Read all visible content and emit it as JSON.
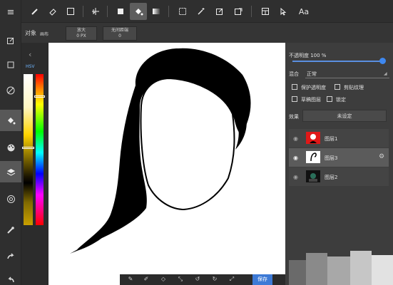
{
  "top_toolbar": {
    "text_tool_label": "Aa"
  },
  "options": {
    "object_label": "对象",
    "object_value": "画布",
    "zoom_label": "放大",
    "zoom_value": "0 PX",
    "snap_label": "无间距端",
    "snap_value": "0"
  },
  "color": {
    "mode_label": "HSV"
  },
  "layers_panel": {
    "opacity_label": "不透明度 100 %",
    "blend_label": "混合",
    "blend_value": "正常",
    "protect_alpha_label": "保护透明度",
    "clip_label": "剪贴纹理",
    "draft_label": "草稿图层",
    "lock_label": "锁定",
    "effect_label": "效果",
    "effect_value": "未设定",
    "layers": [
      {
        "name": "图层1",
        "selected": false
      },
      {
        "name": "图层3",
        "selected": true
      },
      {
        "name": "图层2",
        "selected": false
      }
    ]
  },
  "bottom_bar": {
    "save_label": "保存"
  },
  "colors": {
    "accent": "#3e88f0",
    "panel_bg": "#3d3d3d",
    "toolbar_bg": "#2f2f2f"
  }
}
